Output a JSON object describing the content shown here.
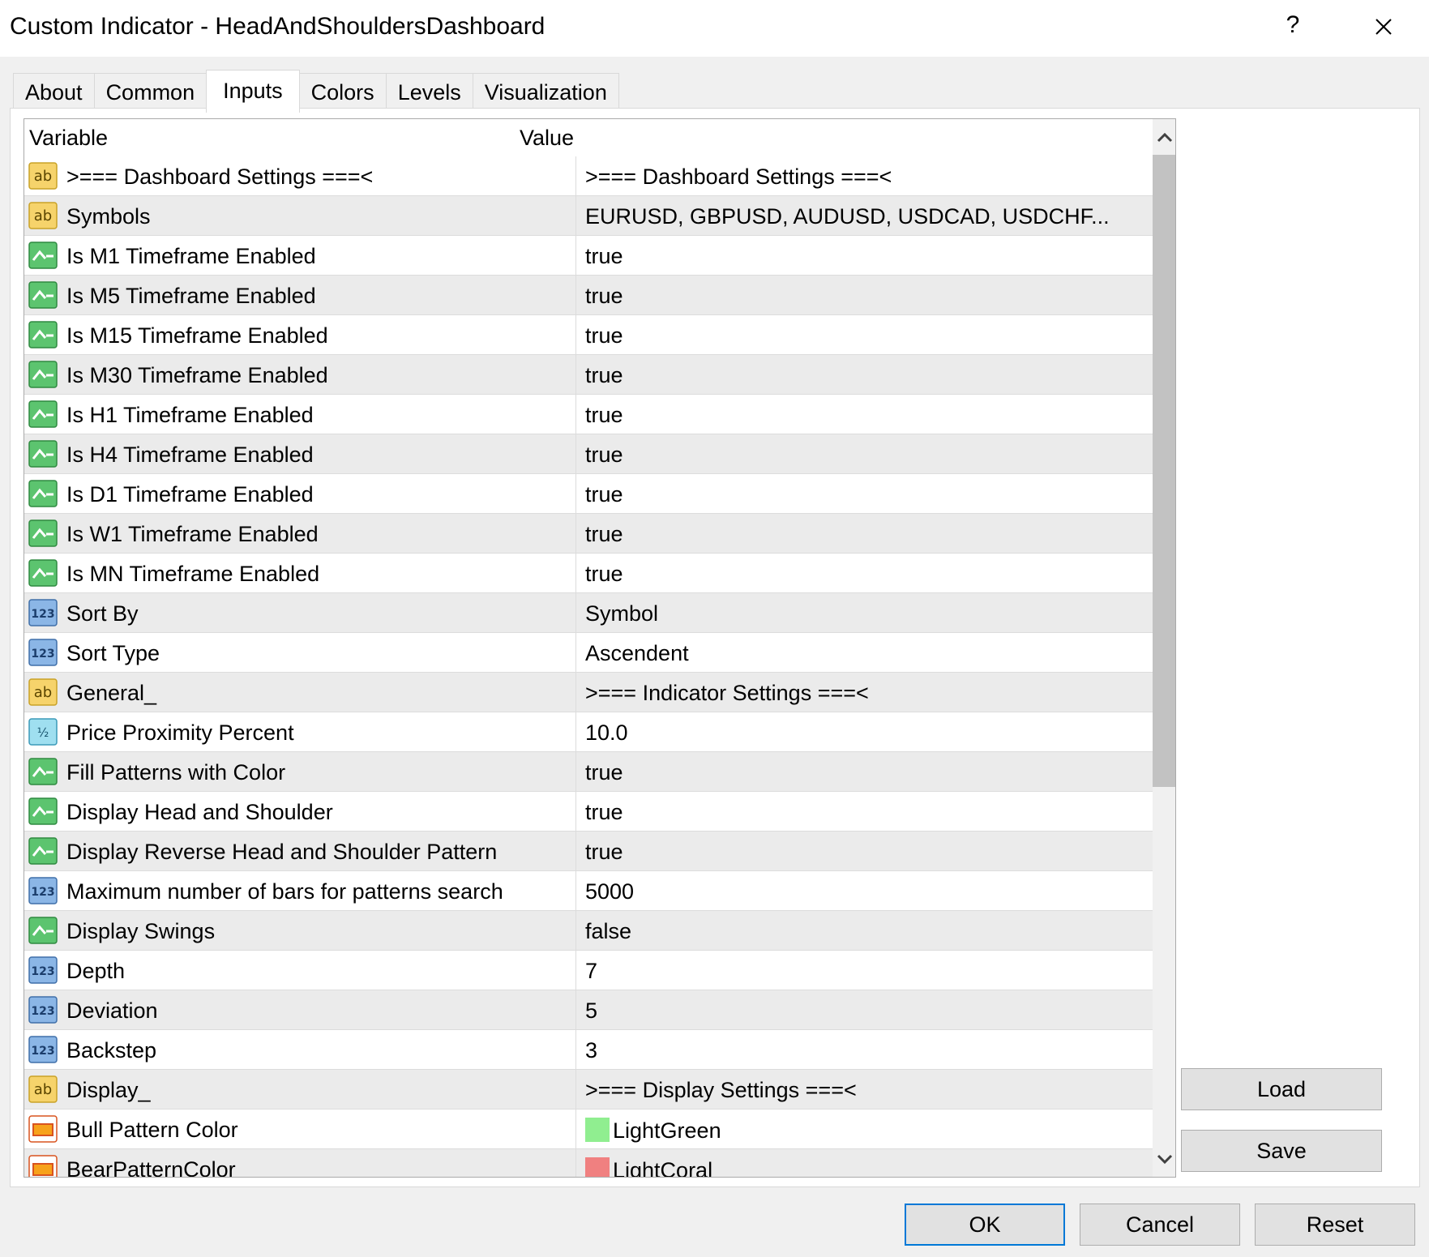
{
  "window": {
    "title": "Custom Indicator - HeadAndShouldersDashboard",
    "help_label": "?"
  },
  "tabs": [
    {
      "label": "About",
      "active": false
    },
    {
      "label": "Common",
      "active": false
    },
    {
      "label": "Inputs",
      "active": true
    },
    {
      "label": "Colors",
      "active": false
    },
    {
      "label": "Levels",
      "active": false
    },
    {
      "label": "Visualization",
      "active": false
    }
  ],
  "grid": {
    "columns": [
      "Variable",
      "Value"
    ],
    "rows": [
      {
        "type": "string",
        "icon": "ab-string-icon",
        "variable": ">=== Dashboard Settings ===<",
        "value": ">=== Dashboard Settings ===<"
      },
      {
        "type": "string",
        "icon": "ab-string-icon",
        "variable": "Symbols",
        "value": "EURUSD, GBPUSD, AUDUSD, USDCAD, USDCHF..."
      },
      {
        "type": "bool",
        "icon": "bool-icon",
        "variable": "Is M1 Timeframe Enabled",
        "value": "true"
      },
      {
        "type": "bool",
        "icon": "bool-icon",
        "variable": "Is M5 Timeframe Enabled",
        "value": "true"
      },
      {
        "type": "bool",
        "icon": "bool-icon",
        "variable": "Is M15 Timeframe Enabled",
        "value": "true"
      },
      {
        "type": "bool",
        "icon": "bool-icon",
        "variable": "Is M30 Timeframe Enabled",
        "value": "true"
      },
      {
        "type": "bool",
        "icon": "bool-icon",
        "variable": "Is H1 Timeframe Enabled",
        "value": "true"
      },
      {
        "type": "bool",
        "icon": "bool-icon",
        "variable": "Is H4 Timeframe Enabled",
        "value": "true"
      },
      {
        "type": "bool",
        "icon": "bool-icon",
        "variable": "Is D1 Timeframe Enabled",
        "value": "true"
      },
      {
        "type": "bool",
        "icon": "bool-icon",
        "variable": "Is W1 Timeframe Enabled",
        "value": "true"
      },
      {
        "type": "bool",
        "icon": "bool-icon",
        "variable": "Is MN Timeframe Enabled",
        "value": "true"
      },
      {
        "type": "int",
        "icon": "int-123-icon",
        "variable": "Sort By",
        "value": "Symbol"
      },
      {
        "type": "int",
        "icon": "int-123-icon",
        "variable": "Sort Type",
        "value": "Ascendent"
      },
      {
        "type": "string",
        "icon": "ab-string-icon",
        "variable": "General_",
        "value": ">=== Indicator Settings ===<"
      },
      {
        "type": "double",
        "icon": "double-half-icon",
        "variable": "Price Proximity Percent",
        "value": "10.0"
      },
      {
        "type": "bool",
        "icon": "bool-icon",
        "variable": "Fill Patterns with Color",
        "value": "true"
      },
      {
        "type": "bool",
        "icon": "bool-icon",
        "variable": "Display Head and Shoulder",
        "value": "true"
      },
      {
        "type": "bool",
        "icon": "bool-icon",
        "variable": "Display Reverse Head and Shoulder Pattern",
        "value": "true"
      },
      {
        "type": "int",
        "icon": "int-123-icon",
        "variable": "Maximum number of bars for patterns search",
        "value": "5000"
      },
      {
        "type": "bool",
        "icon": "bool-icon",
        "variable": "Display Swings",
        "value": "false"
      },
      {
        "type": "int",
        "icon": "int-123-icon",
        "variable": "Depth",
        "value": "7"
      },
      {
        "type": "int",
        "icon": "int-123-icon",
        "variable": "Deviation",
        "value": "5"
      },
      {
        "type": "int",
        "icon": "int-123-icon",
        "variable": "Backstep",
        "value": "3"
      },
      {
        "type": "string",
        "icon": "ab-string-icon",
        "variable": "Display_",
        "value": ">=== Display Settings ===<"
      },
      {
        "type": "color",
        "icon": "color-icon",
        "variable": "Bull Pattern Color",
        "value": "LightGreen",
        "swatch": "#90ee90"
      },
      {
        "type": "color",
        "icon": "color-icon",
        "variable": "BearPatternColor",
        "value": "LightCoral",
        "swatch": "#f08080"
      }
    ]
  },
  "side_buttons": {
    "load_label": "Load",
    "save_label": "Save"
  },
  "footer_buttons": {
    "ok_label": "OK",
    "cancel_label": "Cancel",
    "reset_label": "Reset"
  },
  "colors": {
    "accent": "#0078d7",
    "row_alt": "#ebebeb",
    "bool_green": "#2fa84f",
    "string_yellow": "#f2c94c",
    "int_blue": "#4a86c8",
    "color_orange": "#f58220"
  }
}
